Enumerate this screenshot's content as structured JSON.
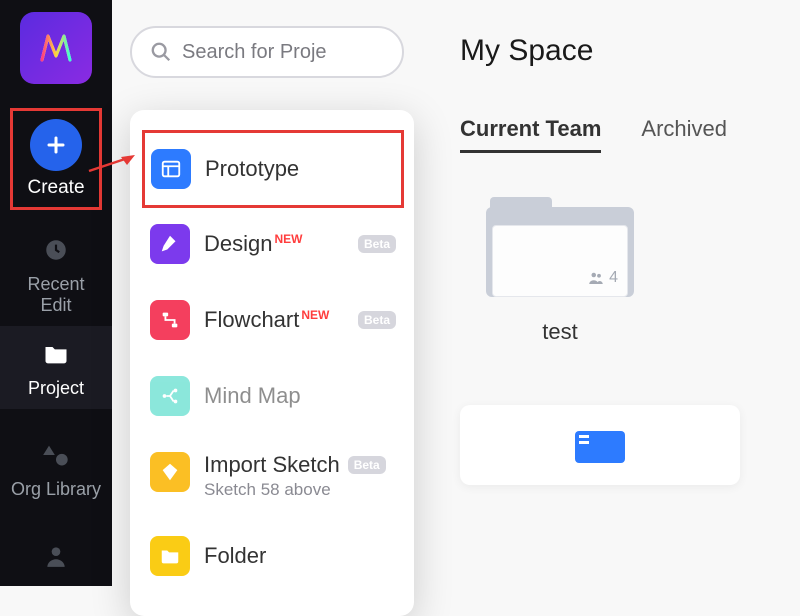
{
  "rail": {
    "create_label": "Create",
    "recent_label_1": "Recent",
    "recent_label_2": "Edit",
    "project_label": "Project",
    "org_label": "Org Library"
  },
  "search": {
    "placeholder": "Search for Proje"
  },
  "menu": {
    "prototype": "Prototype",
    "design": "Design",
    "design_badge": "NEW",
    "design_beta": "Beta",
    "flowchart": "Flowchart",
    "flowchart_badge": "NEW",
    "flowchart_beta": "Beta",
    "mindmap": "Mind Map",
    "import_sketch": "Import Sketch",
    "import_sketch_beta": "Beta",
    "import_sketch_sub": "Sketch 58 above",
    "folder": "Folder"
  },
  "main": {
    "title": "My Space",
    "tab_current": "Current Team",
    "tab_archived": "Archived",
    "folder_count": "4",
    "folder_name": "test"
  },
  "colors": {
    "accent": "#2563eb",
    "highlight": "#e53935"
  }
}
